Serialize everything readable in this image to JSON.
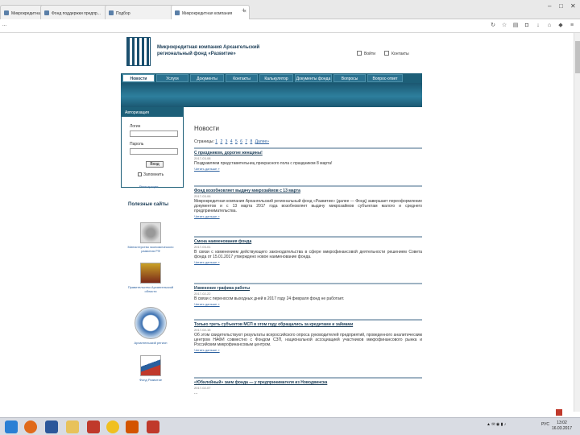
{
  "browser": {
    "tabs": [
      {
        "label": "Микрокредитная компания..."
      },
      {
        "label": "Фонд поддержки предпр..."
      },
      {
        "label": "Подбор"
      },
      {
        "label": "Микрокредитная компания"
      }
    ],
    "new_tab_symbol": "+",
    "address": "...",
    "window_controls": [
      "–",
      "□",
      "✕"
    ]
  },
  "site": {
    "org_name": "Микрокредитная компания Архангельский региональный фонд «Развитие»",
    "header_links": [
      {
        "label": "Войти"
      },
      {
        "label": "Контакты"
      }
    ],
    "menu": [
      {
        "label": "Новости"
      },
      {
        "label": "Услуги"
      },
      {
        "label": "Документы"
      },
      {
        "label": "Контакты"
      },
      {
        "label": "Калькулятор"
      },
      {
        "label": "Документы фонда"
      },
      {
        "label": "Вопросы"
      },
      {
        "label": "Вопрос-ответ"
      }
    ],
    "login": {
      "title": "Авторизация",
      "login_label": "Логин",
      "password_label": "Пароль",
      "submit": "Вход",
      "remember": "Запомнить",
      "register": "Регистрация"
    },
    "useful_sites_title": "Полезные сайты",
    "partners": [
      {
        "caption": "Министерство экономического развития РФ"
      },
      {
        "caption": "Правительство Архангельской области"
      },
      {
        "caption": "Архангельский регион"
      },
      {
        "caption": "Фонд Развитие"
      }
    ],
    "news": {
      "heading": "Новости",
      "pager_label": "Страницы:",
      "pages": [
        "1",
        "2",
        "3",
        "4",
        "5",
        "6",
        "7",
        "8",
        "Далее»"
      ],
      "items": [
        {
          "title": "С праздником, дорогие женщины!",
          "date": "2017-03-08",
          "text": "Поздравляем представительниц прекрасного пола с праздником 8 марта!",
          "more": "Читать дальше »"
        },
        {
          "title": "Фонд возобновляет выдачу микрозаймов с 13 марта",
          "date": "2017-03-06",
          "text": "Микрокредитная компания Архангельский региональный фонд «Развитие» (далее — Фонд) завершает переоформление документов и с 13 марта 2017 года возобновляет выдачу микрозаймов субъектам малого и среднего предпринимательства.",
          "more": "Читать дальше »"
        },
        {
          "title": "Смена наименования фонда",
          "date": "2017-03-01",
          "text": "В связи с изменением действующего законодательства в сфере микрофинансовой деятельности решением Совета фонда от 15.01.2017 утверждено новое наименование фонда.",
          "more": "Читать дальше »"
        },
        {
          "title": "Изменение графика работы",
          "date": "2017-02-22",
          "text": "В связи с переносом выходных дней в 2017 году 24 февраля фонд не работает.",
          "more": "Читать дальше »"
        },
        {
          "title": "Только треть субъектов МСП в этом году обращались за кредитами и займами",
          "date": "2017-02-15",
          "text": "Об этом свидетельствуют результаты всероссийского опроса руководителей предприятий, проведенного аналитическим центром НАФИ совместно с Фондом СЗП, национальной ассоциацией участников микрофинансового рынка и Российским микрофинансовым центром.",
          "more": "Читать дальше »"
        },
        {
          "title": "«Юбилейный» заем фонда — у предпринимателя из Новодвинска",
          "date": "2017-02-07",
          "text": "...",
          "more": ""
        }
      ]
    }
  },
  "taskbar": {
    "language": "РУС",
    "time": "13:02",
    "date": "16.03.2017"
  },
  "colors": {
    "menu": "#1d5f78",
    "banner": "#2d7f9d",
    "link": "#2a5f9e"
  }
}
